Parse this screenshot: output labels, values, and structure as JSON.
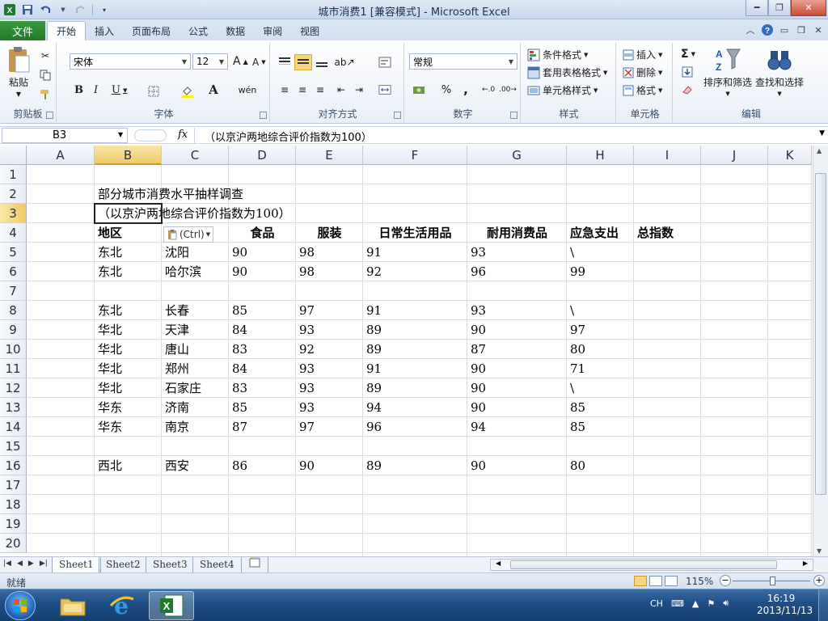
{
  "window": {
    "title": "城市消费1  [兼容模式] - Microsoft Excel",
    "minimize_icon": "minimize-icon",
    "maximize_icon": "restore-icon",
    "close_icon": "close-icon"
  },
  "ribbon_tabs": {
    "file": "文件",
    "items": [
      "开始",
      "插入",
      "页面布局",
      "公式",
      "数据",
      "审阅",
      "视图"
    ],
    "active": "开始"
  },
  "ribbon": {
    "clipboard": {
      "label": "剪贴板",
      "paste": "粘贴"
    },
    "font": {
      "label": "字体",
      "name": "宋体",
      "size": "12"
    },
    "alignment": {
      "label": "对齐方式"
    },
    "number": {
      "label": "数字",
      "format": "常规"
    },
    "styles": {
      "label": "样式",
      "conditional": "条件格式",
      "table": "套用表格格式",
      "cell": "单元格样式"
    },
    "cells": {
      "label": "单元格",
      "insert": "插入",
      "delete": "删除",
      "format": "格式"
    },
    "editing": {
      "label": "编辑",
      "sort": "排序和筛选",
      "find": "查找和选择"
    }
  },
  "formula_bar": {
    "name_box": "B3",
    "fx": "fx",
    "content": "（以京沪两地综合评价指数为100）"
  },
  "columns": [
    "A",
    "B",
    "C",
    "D",
    "E",
    "F",
    "G",
    "H",
    "I",
    "J",
    "K"
  ],
  "selected_column": "B",
  "rows": [
    "1",
    "2",
    "3",
    "4",
    "5",
    "6",
    "7",
    "8",
    "9",
    "10",
    "11",
    "12",
    "13",
    "14",
    "15",
    "16",
    "17",
    "18",
    "19",
    "20"
  ],
  "selected_row": "3",
  "cells": {
    "title": "部分城市消费水平抽样调查",
    "subtitle": "（以京沪两地综合评价指数为100）",
    "headers": [
      "地区",
      "",
      "食品",
      "服装",
      "日常生活用品",
      "耐用消费品",
      "应急支出",
      "总指数"
    ],
    "data": [
      {
        "row": 5,
        "values": [
          "东北",
          "沈阳",
          "90",
          "98",
          "91",
          "93",
          "\\"
        ]
      },
      {
        "row": 6,
        "values": [
          "东北",
          "哈尔滨",
          "90",
          "98",
          "92",
          "96",
          "99"
        ]
      },
      {
        "row": 8,
        "values": [
          "东北",
          "长春",
          "85",
          "97",
          "91",
          "93",
          "\\"
        ]
      },
      {
        "row": 9,
        "values": [
          "华北",
          "天津",
          "84",
          "93",
          "89",
          "90",
          "97"
        ]
      },
      {
        "row": 10,
        "values": [
          "华北",
          "唐山",
          "83",
          "92",
          "89",
          "87",
          "80"
        ]
      },
      {
        "row": 11,
        "values": [
          "华北",
          "郑州",
          "84",
          "93",
          "91",
          "90",
          "71"
        ]
      },
      {
        "row": 12,
        "values": [
          "华北",
          "石家庄",
          "83",
          "93",
          "89",
          "90",
          "\\"
        ]
      },
      {
        "row": 13,
        "values": [
          "华东",
          "济南",
          "85",
          "93",
          "94",
          "90",
          "85"
        ]
      },
      {
        "row": 14,
        "values": [
          "华东",
          "南京",
          "87",
          "97",
          "96",
          "94",
          "85"
        ]
      },
      {
        "row": 16,
        "values": [
          "西北",
          "西安",
          "86",
          "90",
          "89",
          "90",
          "80"
        ]
      }
    ]
  },
  "paste_options": {
    "label": "(Ctrl)"
  },
  "sheets": [
    "Sheet1",
    "Sheet2",
    "Sheet3",
    "Sheet4"
  ],
  "active_sheet": "Sheet1",
  "status": {
    "ready": "就绪",
    "zoom": "115%"
  },
  "taskbar": {
    "ime": "CH",
    "time": "16:19",
    "date": "2013/11/13"
  },
  "colors": {
    "excel_green": "#217a24",
    "selection_header": "#f1c96a"
  }
}
